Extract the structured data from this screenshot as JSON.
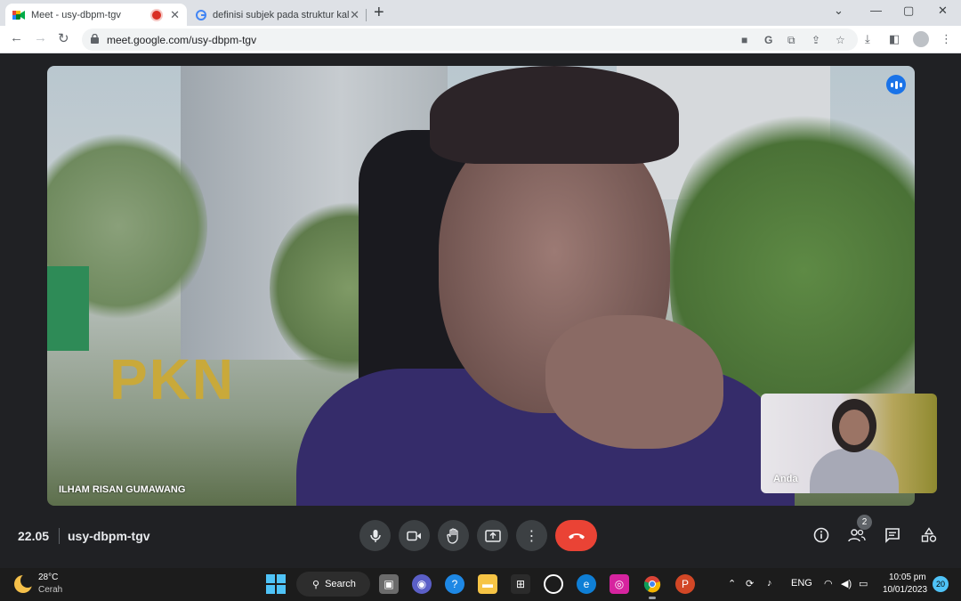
{
  "browser": {
    "tabs": [
      {
        "title": "Meet - usy-dbpm-tgv",
        "active": true,
        "recording": true,
        "favicon": "google-meet-icon"
      },
      {
        "title": "definisi subjek pada struktur kalimat",
        "active": false,
        "favicon": "google-g-icon"
      }
    ],
    "new_tab": "+",
    "window_controls": {
      "minimize": "—",
      "maximize": "▢",
      "close": "✕"
    },
    "url": "meet.google.com/usy-dbpm-tgv",
    "nav": {
      "back": "←",
      "forward": "→",
      "reload": "↻"
    }
  },
  "meeting": {
    "main_participant": "ILHAM RISAN GUMAWANG",
    "self_participant": "Anda",
    "time": "22.05",
    "meeting_code": "usy-dbpm-tgv",
    "participant_count": "2",
    "background_sign_text": "PKN"
  },
  "controls": {
    "mic": "microphone-icon",
    "camera": "camera-icon",
    "raise_hand": "hand-icon",
    "present": "present-icon",
    "more": "more-options-icon",
    "end_call": "end-call-icon",
    "end_call_color": "#ea4335"
  },
  "taskbar": {
    "temperature": "28°C",
    "condition": "Cerah",
    "search_label": "Search",
    "language": "ENG",
    "time": "10:05 pm",
    "date": "10/01/2023",
    "notifications": "20"
  }
}
